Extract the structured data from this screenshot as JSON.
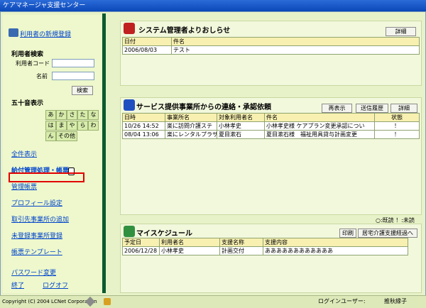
{
  "window": {
    "title": "ケアマネージャ支援センター"
  },
  "sidebar": {
    "new_user_link": "利用者の新規登録",
    "search_heading": "利用者検索",
    "user_code_label": "利用者コード",
    "name_label": "名前",
    "search_button": "検索",
    "kana_heading": "五十音表示",
    "kana": [
      "あ",
      "か",
      "さ",
      "た",
      "な",
      "は",
      "ま",
      "や",
      "ら",
      "わ",
      "ん"
    ],
    "kana_other": "その他",
    "links": {
      "all": "全件表示",
      "billing": "給付管理処理・帳票",
      "management": "管理帳票",
      "profile": "プロフィール設定",
      "add_partner": "取引先事業所の追加",
      "unregistered": "未登録事業所登録",
      "template": "帳票テンプレート",
      "password": "パスワード変更",
      "exit": "終了",
      "logoff": "ログオフ"
    }
  },
  "notice": {
    "title": "システム管理者よりおしらせ",
    "detail_button": "詳細",
    "columns": [
      "日付",
      "件名"
    ],
    "rows": [
      [
        "2006/08/03",
        "テスト"
      ]
    ]
  },
  "contact": {
    "title": "サービス提供事業所からの連絡・承認依頼",
    "redisplay_button": "再表示",
    "history_button": "送信履歴",
    "detail_button": "詳細",
    "columns": [
      "日時",
      "事業所名",
      "対象利用者名",
      "件名",
      "状態"
    ],
    "rows": [
      [
        "10/26 14:52",
        "楽に訪問介護ステ",
        "小林孝史",
        "小林孝史様 ケアプラン変更承認につい",
        "！"
      ],
      [
        "08/04 13:06",
        "楽にレンタルプラザ",
        "夏目漱石",
        "夏目漱石様　福祉用具貸与計画変更",
        "！"
      ]
    ],
    "legend": "○:既読 ！:未読"
  },
  "schedule": {
    "title": "マイスケジュール",
    "print_button": "印刷",
    "connect_button": "居宅介護支援経過へ",
    "columns": [
      "予定日",
      "利用者名",
      "支援名称",
      "支援内容"
    ],
    "rows": [
      [
        "2006/12/28",
        "小林孝史",
        "計画交付",
        "ああああああああああああ"
      ]
    ]
  },
  "status": {
    "copyright": "Copyright (C) 2004 LCNet Corporation",
    "login_label": "ログインユーザー:",
    "login_user": "推秋縁子"
  }
}
